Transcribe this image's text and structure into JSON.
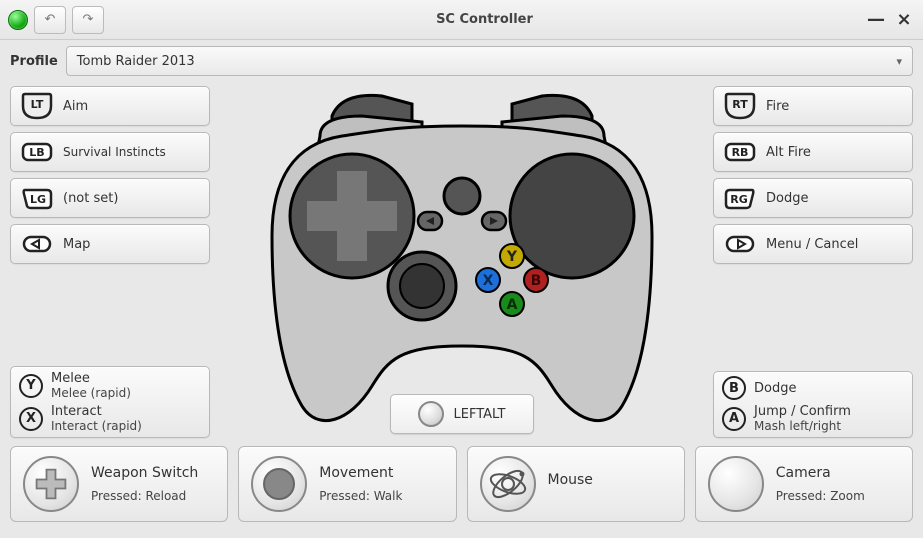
{
  "window": {
    "title": "SC Controller"
  },
  "profile": {
    "label": "Profile",
    "current": "Tomb Raider 2013"
  },
  "left_bindings": {
    "lt": {
      "glyph": "LT",
      "label": "Aim"
    },
    "lb": {
      "glyph": "LB",
      "label": "Survival Instincts"
    },
    "lg": {
      "glyph": "LG",
      "label": "(not set)"
    },
    "back": {
      "glyph": "◁",
      "label": "Map"
    }
  },
  "right_bindings": {
    "rt": {
      "glyph": "RT",
      "label": "Fire"
    },
    "rb": {
      "glyph": "RB",
      "label": "Alt Fire"
    },
    "rg": {
      "glyph": "RG",
      "label": "Dodge"
    },
    "start": {
      "glyph": "▷",
      "label": "Menu / Cancel"
    }
  },
  "face_left": {
    "y": {
      "glyph": "Y",
      "line1": "Melee",
      "line2": "Melee (rapid)"
    },
    "x": {
      "glyph": "X",
      "line1": "Interact",
      "line2": "Interact (rapid)"
    }
  },
  "face_right": {
    "b": {
      "glyph": "B",
      "line1": "Dodge"
    },
    "a": {
      "glyph": "A",
      "line1": "Jump / Confirm",
      "line2": "Mash left/right"
    }
  },
  "center_button": {
    "label": "LEFTALT"
  },
  "bottom": {
    "dpad": {
      "title": "Weapon Switch",
      "sub": "Pressed: Reload"
    },
    "stick": {
      "title": "Movement",
      "sub": "Pressed: Walk"
    },
    "gyro": {
      "title": "Mouse",
      "sub": ""
    },
    "rpad": {
      "title": "Camera",
      "sub": "Pressed: Zoom"
    }
  },
  "icons": {
    "status": "status-online",
    "undo": "↶",
    "redo": "↷",
    "minimize": "—",
    "close": "×",
    "dropdown": "▾"
  }
}
